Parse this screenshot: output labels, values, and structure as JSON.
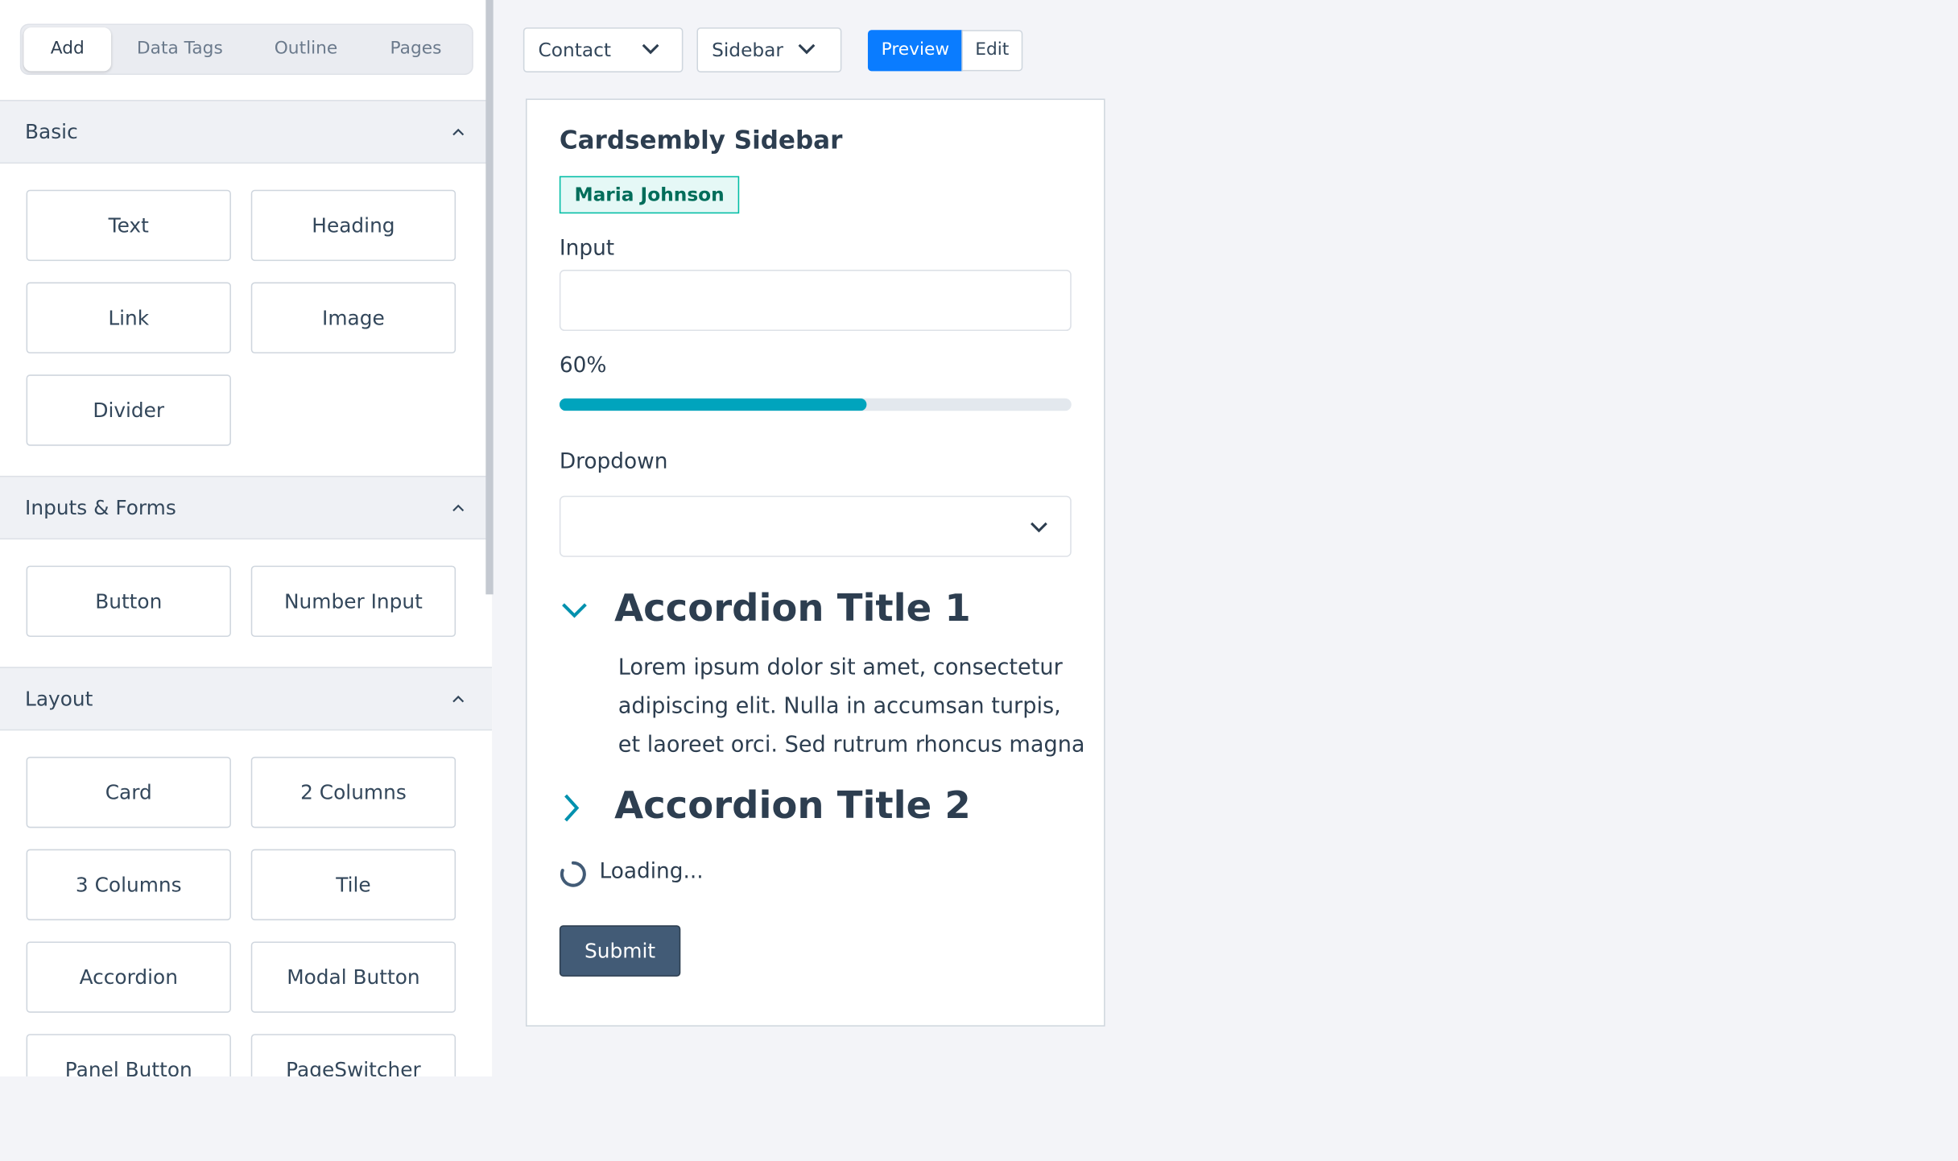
{
  "sidebar": {
    "tabs": [
      "Add",
      "Data Tags",
      "Outline",
      "Pages"
    ],
    "sections": [
      {
        "title": "Basic",
        "items": [
          "Text",
          "Heading",
          "Link",
          "Image",
          "Divider"
        ]
      },
      {
        "title": "Inputs & Forms",
        "items": [
          "Button",
          "Number Input"
        ]
      },
      {
        "title": "Layout",
        "items": [
          "Card",
          "2 Columns",
          "3 Columns",
          "Tile",
          "Accordion",
          "Modal Button",
          "Panel Button",
          "PageSwitcher"
        ]
      }
    ]
  },
  "toolbar": {
    "object_select": "Contact",
    "location_select": "Sidebar",
    "preview_label": "Preview",
    "edit_label": "Edit"
  },
  "preview": {
    "title": "Cardsembly Sidebar",
    "tag": "Maria Johnson",
    "input_label": "Input",
    "input_value": "",
    "progress_label": "60%",
    "progress_value": 0.6,
    "dropdown_label": "Dropdown",
    "dropdown_value": "",
    "accordion": [
      {
        "title": "Accordion Title 1",
        "expanded": true,
        "body_lines": [
          "Lorem ipsum dolor sit amet, consectetur",
          "adipiscing elit. Nulla in accumsan turpis,",
          "et laoreet orci. Sed rutrum rhoncus magna"
        ]
      },
      {
        "title": "Accordion Title 2",
        "expanded": false
      }
    ],
    "loading_text": "Loading...",
    "submit_label": "Submit"
  },
  "colors": {
    "accent": "#0a7cff",
    "progress": "#00a4bd",
    "tag_bg": "#e5f8f6",
    "tag_border": "#00bda5",
    "tag_text": "#006d5a",
    "submit_bg": "#425b76",
    "text": "#2d3e50"
  }
}
